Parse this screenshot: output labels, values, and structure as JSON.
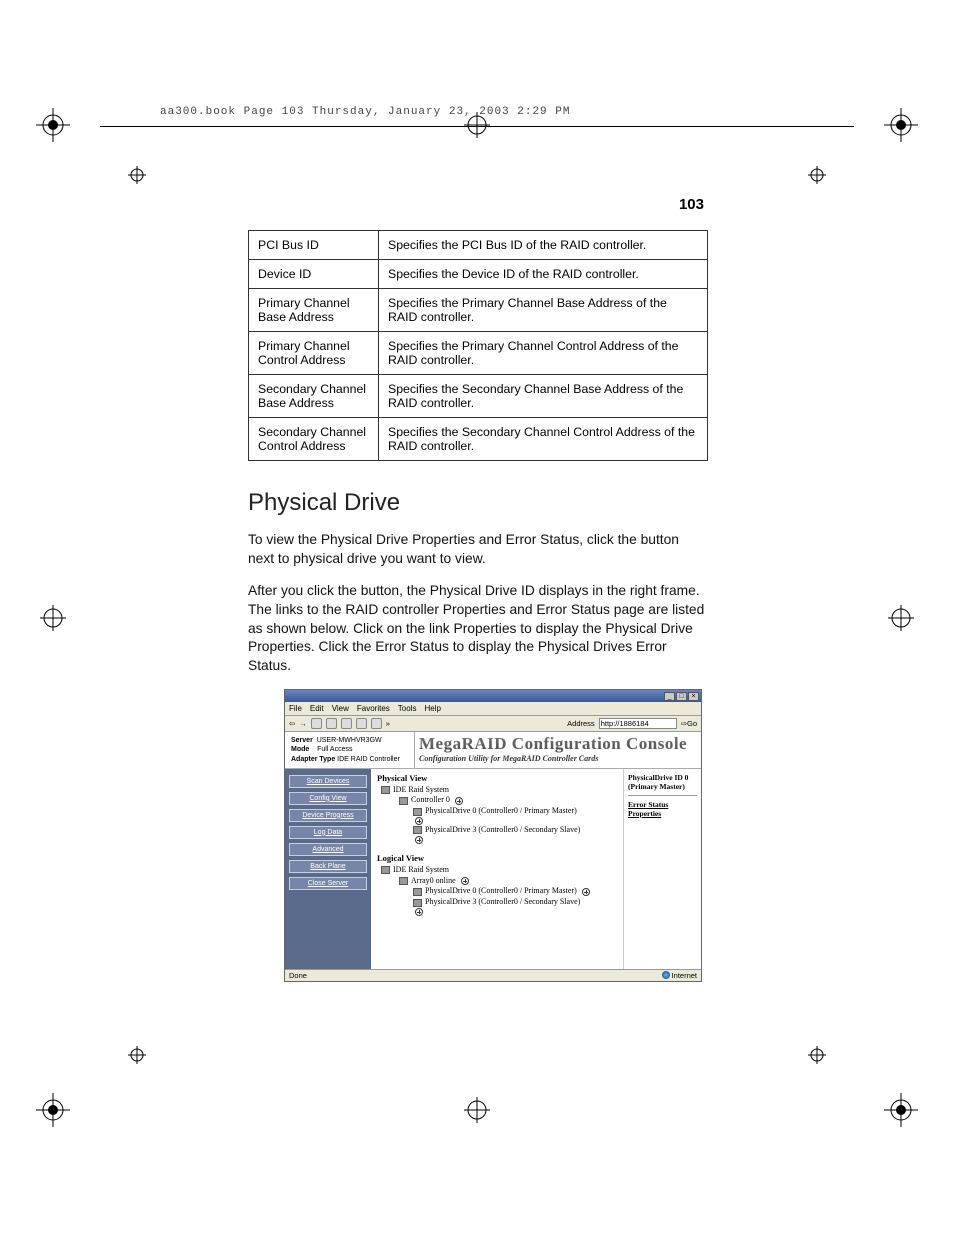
{
  "header_text": "aa300.book  Page 103  Thursday, January 23, 2003  2:29 PM",
  "page_number": "103",
  "table": [
    {
      "k": "PCI Bus ID",
      "v": "Specifies the PCI Bus ID of the RAID controller."
    },
    {
      "k": "Device ID",
      "v": "Specifies the Device ID of the RAID controller."
    },
    {
      "k": "Primary Channel Base Address",
      "v": "Specifies the Primary Channel Base Address of the RAID controller."
    },
    {
      "k": "Primary Channel Control Address",
      "v": "Specifies the Primary Channel Control Address of the RAID controller."
    },
    {
      "k": "Secondary Channel Base Address",
      "v": "Specifies the Secondary Channel Base Address of the RAID controller."
    },
    {
      "k": "Secondary Channel Control Address",
      "v": "Specifies the Secondary Channel Control Address of the RAID controller."
    }
  ],
  "section_title": "Physical Drive",
  "para1": "To view the Physical Drive Properties and Error Status, click the button next to physical drive you want to view.",
  "para2": "After you click the button, the Physical Drive ID displays in the right frame. The links to the RAID controller Properties and Error Status page are listed as shown below. Click on the link Properties to display the Physical Drive Properties. Click the Error Status to display the Physical Drives Error Status.",
  "shot": {
    "menubar": [
      "File",
      "Edit",
      "View",
      "Favorites",
      "Tools",
      "Help"
    ],
    "addr_label": "Address",
    "addr_value": "http://1886184",
    "go": "Go",
    "hb": {
      "server_k": "Server",
      "server_v": "USER-MWHVR3GW",
      "mode_k": "Mode",
      "mode_v": "Full Access",
      "adapter_k": "Adapter Type",
      "adapter_v": "IDE RAID Controller"
    },
    "logo": "MegaRAID Configuration Console",
    "logo_sub": "Configuration Utility for MegaRAID Controller Cards",
    "sidebar": [
      "Scan Devices",
      "Config View",
      "Device Progress",
      "Log Data",
      "Advanced",
      "Back Plane",
      "Close Server"
    ],
    "physical_view": "Physical View",
    "logical_view": "Logical View",
    "tree_phys": {
      "root": "IDE Raid System",
      "ctrl": "Controller 0",
      "d0": "PhysicalDrive 0 (Controller0 / Primary Master)",
      "d3": "PhysicalDrive 3 (Controller0 / Secondary Slave)"
    },
    "tree_log": {
      "root": "IDE Raid System",
      "arr": "Array0 online",
      "d0": "PhysicalDrive 0 (Controller0 / Primary Master)",
      "d3": "PhysicalDrive 3 (Controller0 / Secondary Slave)"
    },
    "right": {
      "title": "PhysicalDrive ID 0 (Primary Master)",
      "link1": "Error Status",
      "link2": "Properties"
    },
    "status_left": "Done",
    "status_right": "Internet"
  }
}
